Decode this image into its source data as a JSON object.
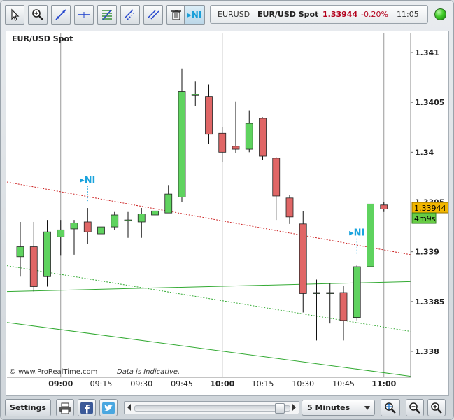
{
  "toolbar": {
    "tools": [
      {
        "name": "pointer-tool",
        "icon": "cursor-arrow-icon"
      },
      {
        "name": "zoom-tool",
        "icon": "magnifier-plus-icon"
      },
      {
        "name": "trendline-tool",
        "icon": "trendline-icon"
      },
      {
        "name": "horizontal-line-tool",
        "icon": "horizontal-line-icon"
      },
      {
        "name": "fibonacci-tool",
        "icon": "fibonacci-icon"
      },
      {
        "name": "channel-tool",
        "icon": "channel-icon"
      },
      {
        "name": "parallel-lines-tool",
        "icon": "parallel-lines-icon"
      },
      {
        "name": "delete-tool",
        "icon": "trash-icon"
      },
      {
        "name": "news-tool",
        "icon": "news-ni-icon",
        "label": "▸NI"
      }
    ]
  },
  "info": {
    "symbol": "EURUSD",
    "name": "EUR/USD Spot",
    "price": "1.33944",
    "change": "-0.20%",
    "time": "11:05"
  },
  "status_color": "#3fcb26",
  "bottom": {
    "settings_label": "Settings",
    "interval_label": "5 Minutes",
    "icons": [
      "print-icon",
      "facebook-icon",
      "twitter-icon",
      "zoom-fit-icon",
      "zoom-out-icon",
      "zoom-in-icon"
    ]
  },
  "chart_data": {
    "type": "candlestick",
    "title": "EUR/USD Spot",
    "footer": "©  www.ProRealTime.com",
    "footer_note": "Data is Indicative.",
    "ylim": [
      1.3378,
      1.3416
    ],
    "y_ticks": [
      "1.338",
      "1.3385",
      "1.339",
      "1.3395",
      "1.34",
      "1.3405",
      "1.341"
    ],
    "x_ticks": [
      {
        "label": "09:00",
        "bold": true
      },
      {
        "label": "09:15",
        "bold": false
      },
      {
        "label": "09:30",
        "bold": false
      },
      {
        "label": "09:45",
        "bold": false
      },
      {
        "label": "10:00",
        "bold": true
      },
      {
        "label": "10:15",
        "bold": false
      },
      {
        "label": "10:30",
        "bold": false
      },
      {
        "label": "10:45",
        "bold": false
      },
      {
        "label": "11:00",
        "bold": true
      }
    ],
    "colors": {
      "up": "#5fd35f",
      "down": "#e06666",
      "grid": "#999999",
      "ma_red": "#cc2222",
      "ma_green": "#33aa33"
    },
    "candles": [
      {
        "o": 1.33895,
        "h": 1.3393,
        "l": 1.33875,
        "c": 1.33905
      },
      {
        "o": 1.33905,
        "h": 1.3393,
        "l": 1.3386,
        "c": 1.33865
      },
      {
        "o": 1.33875,
        "h": 1.33932,
        "l": 1.33865,
        "c": 1.3392
      },
      {
        "o": 1.33915,
        "h": 1.33932,
        "l": 1.33896,
        "c": 1.33922
      },
      {
        "o": 1.33923,
        "h": 1.33932,
        "l": 1.33897,
        "c": 1.33929
      },
      {
        "o": 1.3393,
        "h": 1.33944,
        "l": 1.33908,
        "c": 1.3392
      },
      {
        "o": 1.33918,
        "h": 1.33932,
        "l": 1.3391,
        "c": 1.33925
      },
      {
        "o": 1.33925,
        "h": 1.3394,
        "l": 1.33922,
        "c": 1.33937
      },
      {
        "o": 1.33932,
        "h": 1.3394,
        "l": 1.33914,
        "c": 1.33932
      },
      {
        "o": 1.3393,
        "h": 1.33944,
        "l": 1.33914,
        "c": 1.33938
      },
      {
        "o": 1.33937,
        "h": 1.33944,
        "l": 1.33918,
        "c": 1.33941
      },
      {
        "o": 1.33939,
        "h": 1.33967,
        "l": 1.33939,
        "c": 1.33958
      },
      {
        "o": 1.33955,
        "h": 1.34084,
        "l": 1.3395,
        "c": 1.34061
      },
      {
        "o": 1.34058,
        "h": 1.34071,
        "l": 1.34046,
        "c": 1.34058
      },
      {
        "o": 1.34056,
        "h": 1.34068,
        "l": 1.34008,
        "c": 1.34018
      },
      {
        "o": 1.34019,
        "h": 1.34025,
        "l": 1.3399,
        "c": 1.34
      },
      {
        "o": 1.34006,
        "h": 1.34051,
        "l": 1.33999,
        "c": 1.34003
      },
      {
        "o": 1.34003,
        "h": 1.34042,
        "l": 1.34,
        "c": 1.34029
      },
      {
        "o": 1.34034,
        "h": 1.34035,
        "l": 1.33992,
        "c": 1.33996
      },
      {
        "o": 1.33994,
        "h": 1.33995,
        "l": 1.33932,
        "c": 1.33956
      },
      {
        "o": 1.33954,
        "h": 1.33957,
        "l": 1.33928,
        "c": 1.33935
      },
      {
        "o": 1.33928,
        "h": 1.33941,
        "l": 1.33839,
        "c": 1.33858
      },
      {
        "o": 1.33859,
        "h": 1.33872,
        "l": 1.33811,
        "c": 1.33859
      },
      {
        "o": 1.33859,
        "h": 1.33868,
        "l": 1.33828,
        "c": 1.33859
      },
      {
        "o": 1.33859,
        "h": 1.33866,
        "l": 1.33811,
        "c": 1.33831
      },
      {
        "o": 1.33834,
        "h": 1.33887,
        "l": 1.33831,
        "c": 1.33885
      },
      {
        "o": 1.33885,
        "h": 1.33948,
        "l": 1.33885,
        "c": 1.33948
      },
      {
        "o": 1.33947,
        "h": 1.3395,
        "l": 1.3394,
        "c": 1.33943
      }
    ],
    "ma_red_dotted": [
      [
        1.3397,
        1.33897
      ]
    ],
    "ma_green_dotted": [
      [
        1.33886,
        1.3382
      ]
    ],
    "ma_green_solid": [
      [
        1.3386,
        1.3387
      ]
    ],
    "ma_green_low": [
      [
        1.33829,
        1.33775
      ]
    ],
    "news_markers": [
      {
        "candle": 5,
        "value": 1.33965,
        "label": "▸NI"
      },
      {
        "candle": 25,
        "value": 1.33912,
        "label": "▸NI"
      }
    ],
    "last_price_label": "1.33944",
    "countdown_label": "4m9s"
  }
}
